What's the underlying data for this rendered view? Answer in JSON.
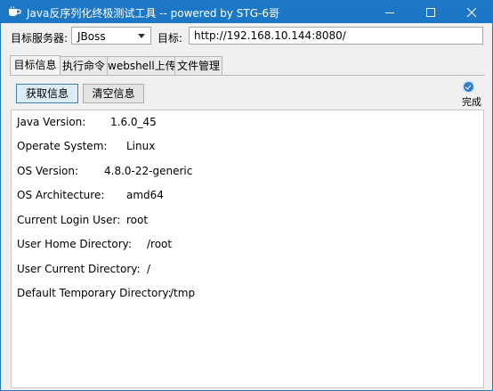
{
  "window": {
    "title": "Java反序列化终极测试工具  -- powered by STG-6哥",
    "controls": {
      "minimize": "minimize-icon",
      "maximize": "maximize-icon",
      "close": "close-icon"
    }
  },
  "toolbar": {
    "server_label": "目标服务器:",
    "server_value": "JBoss",
    "target_label": "目标:",
    "target_value": "http://192.168.10.144:8080/"
  },
  "tabs": [
    {
      "label": "目标信息",
      "active": true
    },
    {
      "label": "执行命令",
      "active": false
    },
    {
      "label": "webshell上传",
      "active": false
    },
    {
      "label": "文件管理",
      "active": false
    }
  ],
  "actions": {
    "get_info": "获取信息",
    "clear_info": "清空信息"
  },
  "status": {
    "text": "完成",
    "color": "#2f7fc7"
  },
  "output": [
    {
      "key": "Java Version:",
      "value": "1.6.0_45"
    },
    {
      "key": "Operate System:",
      "value": "Linux"
    },
    {
      "key": "OS Version:",
      "value": "4.8.0-22-generic"
    },
    {
      "key": "OS Architecture:",
      "value": "amd64"
    },
    {
      "key": "Current Login User:",
      "value": "root"
    },
    {
      "key": "User Home Directory:",
      "value": "/root"
    },
    {
      "key": "User Current Directory:",
      "value": "/"
    },
    {
      "key": "Default Temporary Directory:",
      "value": "/tmp"
    }
  ],
  "colors": {
    "titlebar": "#1c78c6",
    "accent_button_border": "#3c7fb1"
  }
}
